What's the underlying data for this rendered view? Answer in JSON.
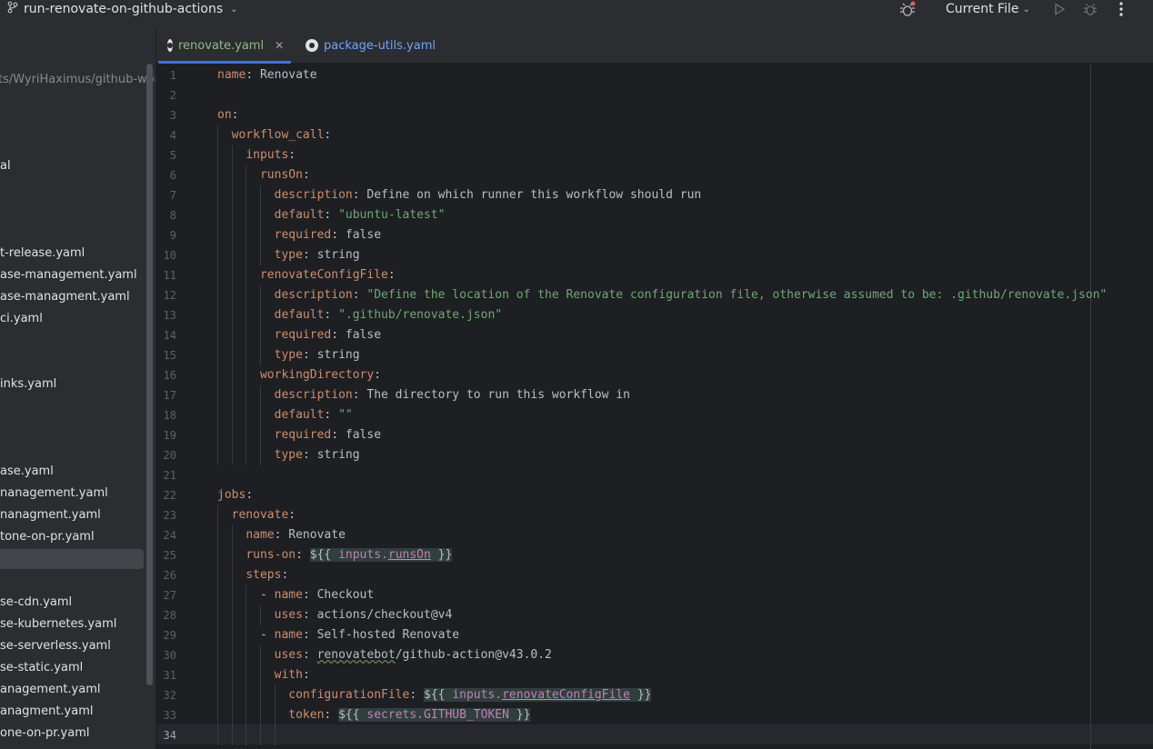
{
  "topbar": {
    "branch": "run-renovate-on-github-actions",
    "run_config": "Current File"
  },
  "sidebar": {
    "path": "ts/WyriHaximus/github-workflows",
    "items": [
      "al",
      "t-release.yaml",
      "ase-management.yaml",
      "ase-managment.yaml",
      "ci.yaml",
      "inks.yaml",
      "ase.yaml",
      "nanagement.yaml",
      "nanagment.yaml",
      "tone-on-pr.yaml",
      "se-cdn.yaml",
      "se-kubernetes.yaml",
      "se-serverless.yaml",
      "se-static.yaml",
      "anagement.yaml",
      "anagment.yaml",
      "one-on-pr.yaml"
    ]
  },
  "tabs": [
    {
      "label": "renovate.yaml",
      "active": true
    },
    {
      "label": "package-utils.yaml",
      "active": false
    }
  ],
  "editor": {
    "current_line": 34,
    "line_numbers": [
      "1",
      "2",
      "3",
      "4",
      "5",
      "6",
      "7",
      "8",
      "9",
      "10",
      "11",
      "12",
      "13",
      "14",
      "15",
      "16",
      "17",
      "18",
      "19",
      "20",
      "21",
      "22",
      "23",
      "24",
      "25",
      "26",
      "27",
      "28",
      "29",
      "30",
      "31",
      "32",
      "33",
      "34"
    ],
    "lines": [
      {
        "indent": "",
        "key": "name",
        "sep": ": ",
        "val": "Renovate",
        "vtype": "plain"
      },
      {
        "indent": "",
        "key": "",
        "sep": "",
        "val": "",
        "vtype": "plain"
      },
      {
        "indent": "",
        "key": "on",
        "sep": ":",
        "val": "",
        "vtype": "plain"
      },
      {
        "indent": "  ",
        "key": "workflow_call",
        "sep": ":",
        "val": "",
        "vtype": "plain"
      },
      {
        "indent": "    ",
        "key": "inputs",
        "sep": ":",
        "val": "",
        "vtype": "plain"
      },
      {
        "indent": "      ",
        "key": "runsOn",
        "sep": ":",
        "val": "",
        "vtype": "plain"
      },
      {
        "indent": "        ",
        "key": "description",
        "sep": ": ",
        "val": "Define on which runner this workflow should run",
        "vtype": "plain"
      },
      {
        "indent": "        ",
        "key": "default",
        "sep": ": ",
        "val": "\"ubuntu-latest\"",
        "vtype": "string"
      },
      {
        "indent": "        ",
        "key": "required",
        "sep": ": ",
        "val": "false",
        "vtype": "plain"
      },
      {
        "indent": "        ",
        "key": "type",
        "sep": ": ",
        "val": "string",
        "vtype": "plain"
      },
      {
        "indent": "      ",
        "key": "renovateConfigFile",
        "sep": ":",
        "val": "",
        "vtype": "plain"
      },
      {
        "indent": "        ",
        "key": "description",
        "sep": ": ",
        "val": "\"Define the location of the Renovate configuration file, otherwise assumed to be: .github/renovate.json\"",
        "vtype": "string"
      },
      {
        "indent": "        ",
        "key": "default",
        "sep": ": ",
        "val": "\".github/renovate.json\"",
        "vtype": "string"
      },
      {
        "indent": "        ",
        "key": "required",
        "sep": ": ",
        "val": "false",
        "vtype": "plain"
      },
      {
        "indent": "        ",
        "key": "type",
        "sep": ": ",
        "val": "string",
        "vtype": "plain"
      },
      {
        "indent": "      ",
        "key": "workingDirectory",
        "sep": ":",
        "val": "",
        "vtype": "plain"
      },
      {
        "indent": "        ",
        "key": "description",
        "sep": ": ",
        "val": "The directory to run this workflow in",
        "vtype": "plain"
      },
      {
        "indent": "        ",
        "key": "default",
        "sep": ": ",
        "val": "\"\"",
        "vtype": "string"
      },
      {
        "indent": "        ",
        "key": "required",
        "sep": ": ",
        "val": "false",
        "vtype": "plain"
      },
      {
        "indent": "        ",
        "key": "type",
        "sep": ": ",
        "val": "string",
        "vtype": "plain"
      },
      {
        "indent": "",
        "key": "",
        "sep": "",
        "val": "",
        "vtype": "plain"
      },
      {
        "indent": "",
        "key": "jobs",
        "sep": ":",
        "val": "",
        "vtype": "plain"
      },
      {
        "indent": "  ",
        "key": "renovate",
        "sep": ":",
        "val": "",
        "vtype": "plain"
      },
      {
        "indent": "    ",
        "key": "name",
        "sep": ": ",
        "val": "Renovate",
        "vtype": "plain"
      },
      {
        "indent": "    ",
        "key": "runs-on",
        "sep": ": ",
        "tpl_open": "${{ ",
        "tpl_var": "inputs.",
        "tpl_prop": "runsOn",
        "tpl_close": " }}",
        "vtype": "template"
      },
      {
        "indent": "    ",
        "key": "steps",
        "sep": ":",
        "val": "",
        "vtype": "plain"
      },
      {
        "indent": "      ",
        "dash": "- ",
        "key": "name",
        "sep": ": ",
        "val": "Checkout",
        "vtype": "plain"
      },
      {
        "indent": "        ",
        "key": "uses",
        "sep": ": ",
        "val": "actions/checkout@v4",
        "vtype": "plain"
      },
      {
        "indent": "      ",
        "dash": "- ",
        "key": "name",
        "sep": ": ",
        "val": "Self-hosted Renovate",
        "vtype": "plain"
      },
      {
        "indent": "        ",
        "key": "uses",
        "sep": ": ",
        "val_squig": "renovatebot",
        "val": "/github-action@v43.0.2",
        "vtype": "squig"
      },
      {
        "indent": "        ",
        "key": "with",
        "sep": ":",
        "val": "",
        "vtype": "plain"
      },
      {
        "indent": "          ",
        "key": "configurationFile",
        "sep": ": ",
        "tpl_open": "${{ ",
        "tpl_var": "inputs.",
        "tpl_prop": "renovateConfigFile",
        "tpl_close": " }}",
        "vtype": "template"
      },
      {
        "indent": "          ",
        "key": "token",
        "sep": ": ",
        "tpl_open": "${{ ",
        "tpl_var": "secrets.GITHUB_TOKEN",
        "tpl_prop": "",
        "tpl_close": " }}",
        "vtype": "template"
      },
      {
        "indent": "",
        "key": "",
        "sep": "",
        "val": "",
        "vtype": "plain"
      }
    ]
  }
}
